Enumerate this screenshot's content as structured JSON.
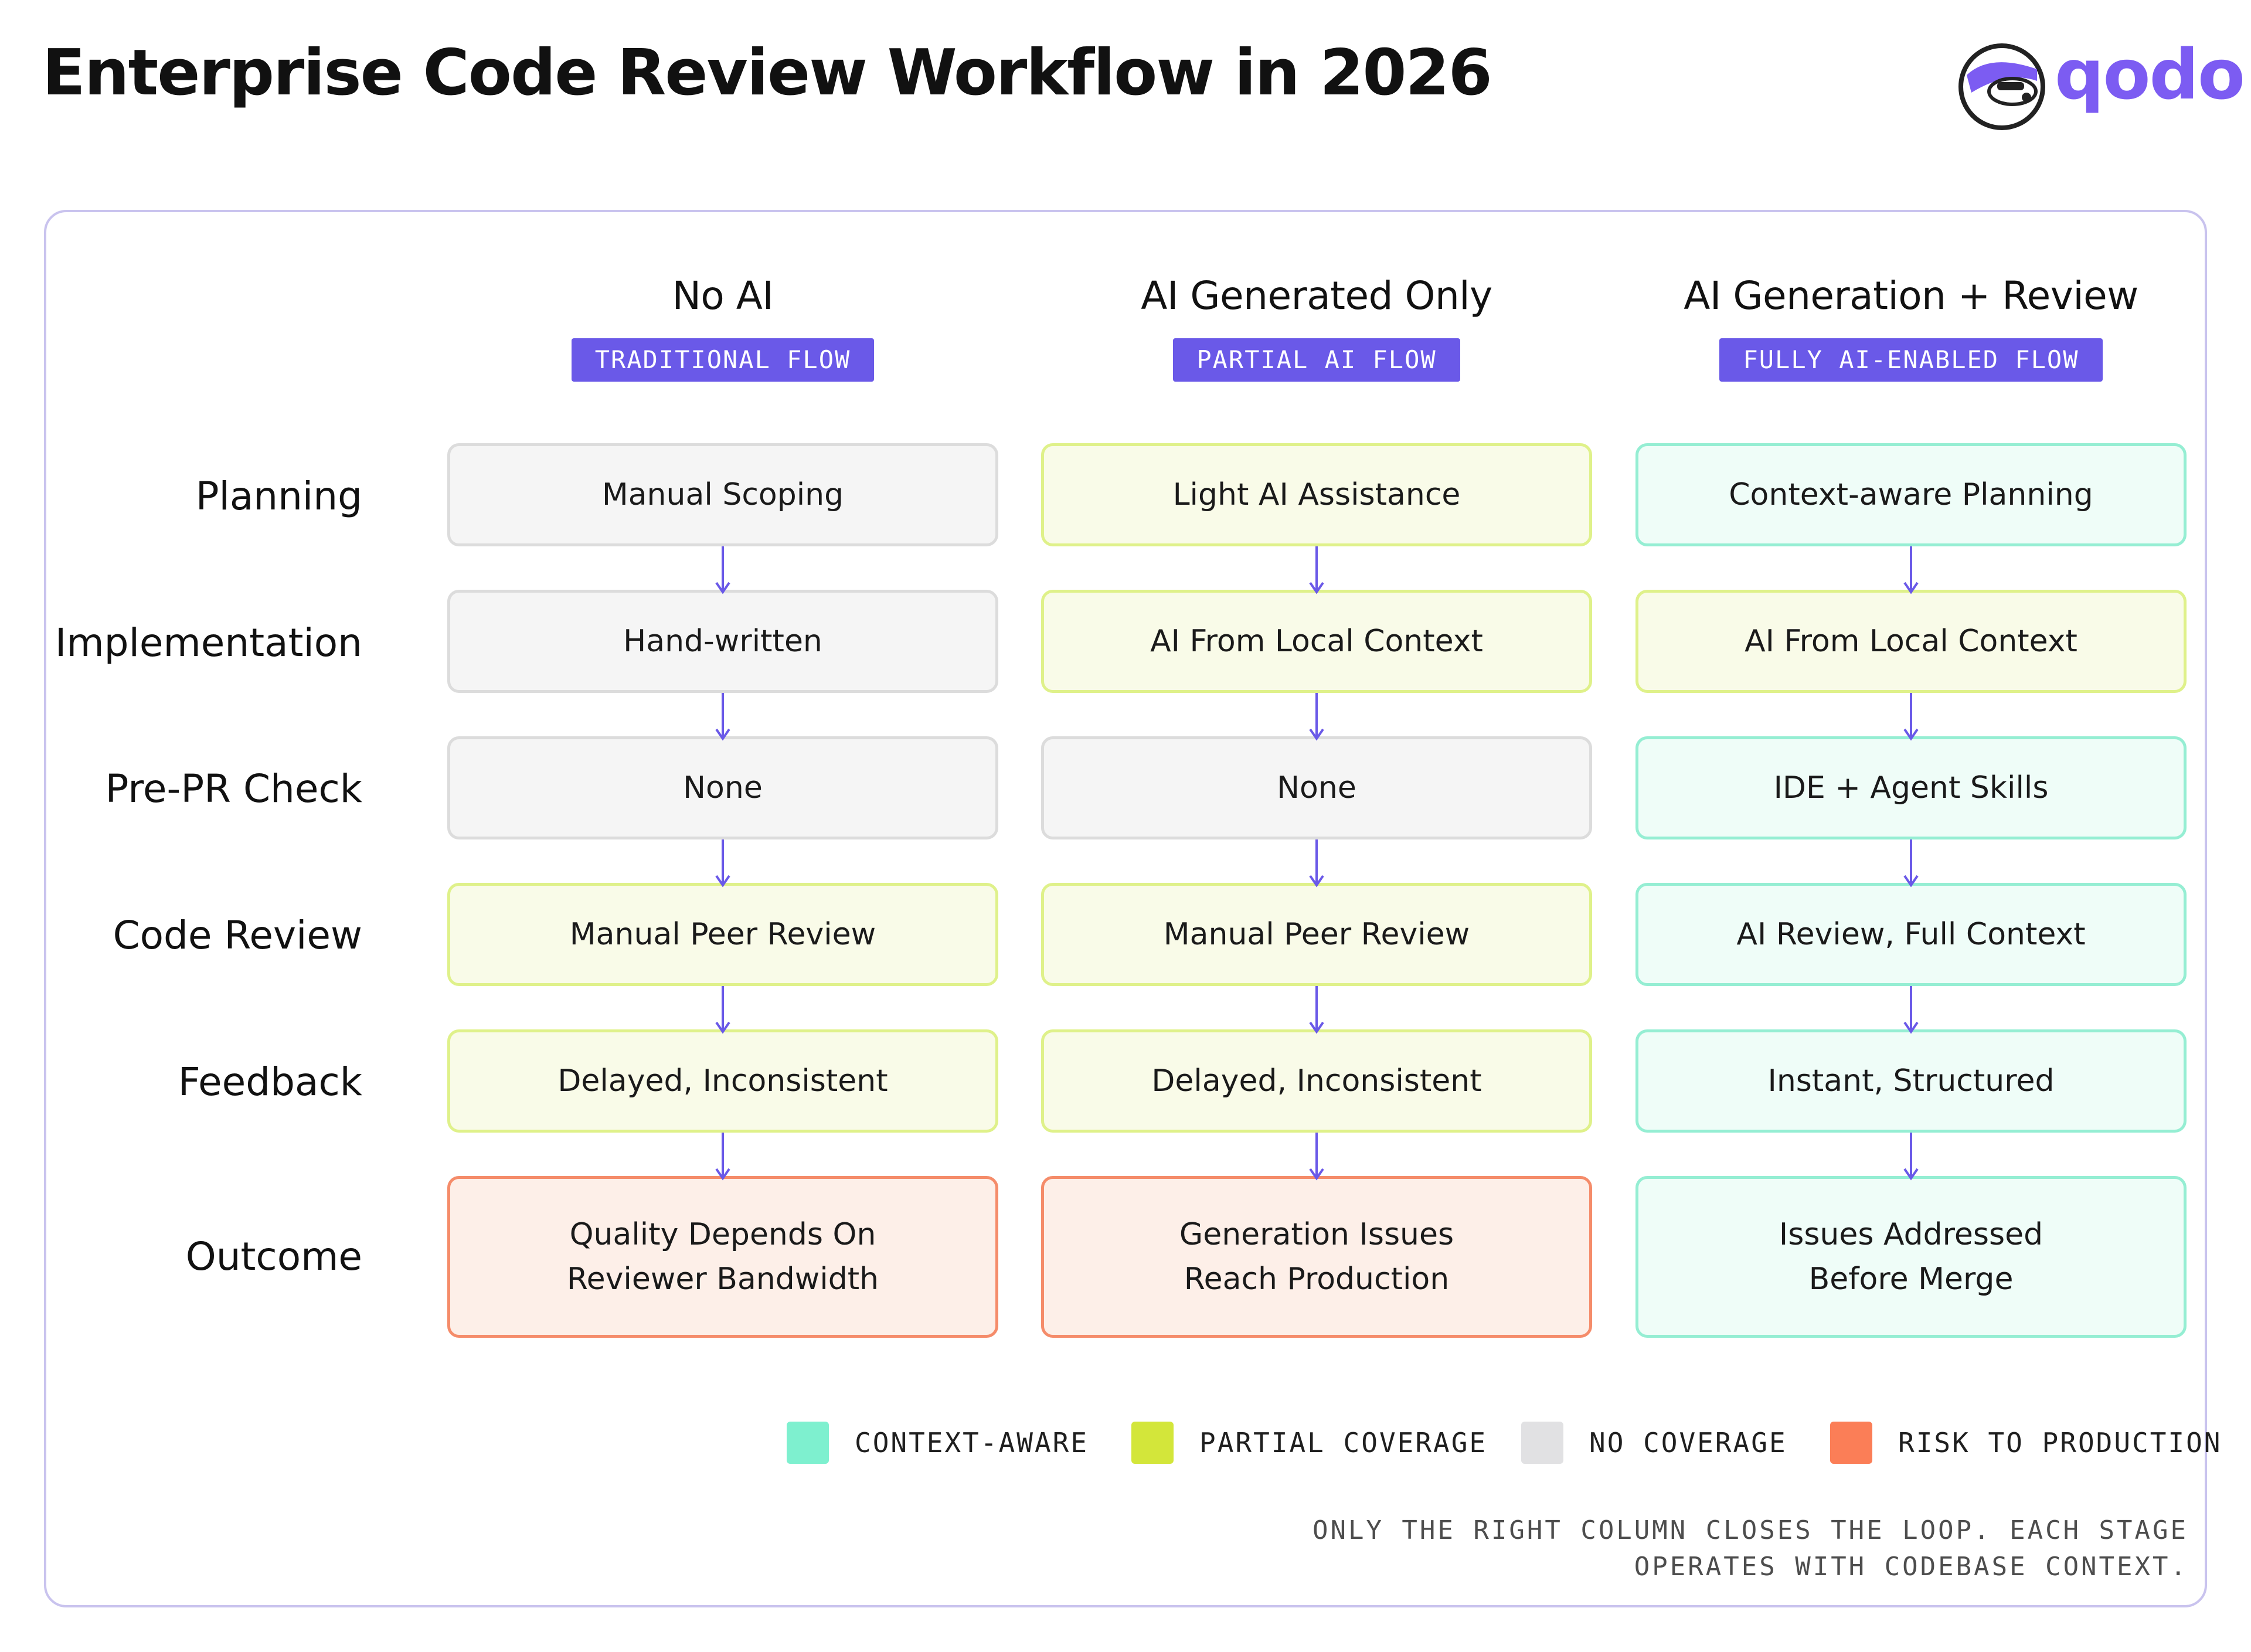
{
  "title": "Enterprise Code Review Workflow in 2026",
  "brand": {
    "name": "qodo",
    "icon": "qodo-mascot-icon",
    "color": "#7c5cf2"
  },
  "columns": [
    {
      "title": "No AI",
      "badge": "TRADITIONAL FLOW"
    },
    {
      "title": "AI Generated Only",
      "badge": "PARTIAL AI FLOW"
    },
    {
      "title": "AI Generation + Review",
      "badge": "FULLY AI-ENABLED FLOW"
    }
  ],
  "rows": [
    {
      "label": "Planning",
      "cells": [
        {
          "text": "Manual Scoping",
          "status": "none"
        },
        {
          "text": "Light AI Assistance",
          "status": "partial"
        },
        {
          "text": "Context-aware Planning",
          "status": "context"
        }
      ]
    },
    {
      "label": "Implementation",
      "cells": [
        {
          "text": "Hand-written",
          "status": "none"
        },
        {
          "text": "AI From Local Context",
          "status": "partial"
        },
        {
          "text": "AI From Local Context",
          "status": "partial"
        }
      ]
    },
    {
      "label": "Pre-PR Check",
      "cells": [
        {
          "text": "None",
          "status": "none"
        },
        {
          "text": "None",
          "status": "none"
        },
        {
          "text": "IDE + Agent Skills",
          "status": "context"
        }
      ]
    },
    {
      "label": "Code Review",
      "cells": [
        {
          "text": "Manual Peer Review",
          "status": "partial"
        },
        {
          "text": "Manual Peer Review",
          "status": "partial"
        },
        {
          "text": "AI Review, Full Context",
          "status": "context"
        }
      ]
    },
    {
      "label": "Feedback",
      "cells": [
        {
          "text": "Delayed, Inconsistent",
          "status": "partial"
        },
        {
          "text": "Delayed, Inconsistent",
          "status": "partial"
        },
        {
          "text": "Instant, Structured",
          "status": "context"
        }
      ]
    },
    {
      "label": "Outcome",
      "cells": [
        {
          "text": "Quality Depends On\nReviewer Bandwidth",
          "status": "risk"
        },
        {
          "text": "Generation Issues\nReach Production",
          "status": "risk"
        },
        {
          "text": "Issues Addressed\nBefore Merge",
          "status": "context"
        }
      ]
    }
  ],
  "legend": [
    {
      "label": "CONTEXT-AWARE",
      "color": "#7ef0cf"
    },
    {
      "label": "PARTIAL COVERAGE",
      "color": "#d3e63a"
    },
    {
      "label": "NO COVERAGE",
      "color": "#e1e1e3"
    },
    {
      "label": "RISK TO PRODUCTION",
      "color": "#fb7e57"
    }
  ],
  "colors": {
    "accent": "#6a59e8",
    "arrow": "#6a59e8",
    "panel_border": "#c9c3ee"
  },
  "footnote": [
    "ONLY THE RIGHT COLUMN CLOSES THE LOOP. EACH STAGE",
    "OPERATES WITH CODEBASE CONTEXT."
  ]
}
